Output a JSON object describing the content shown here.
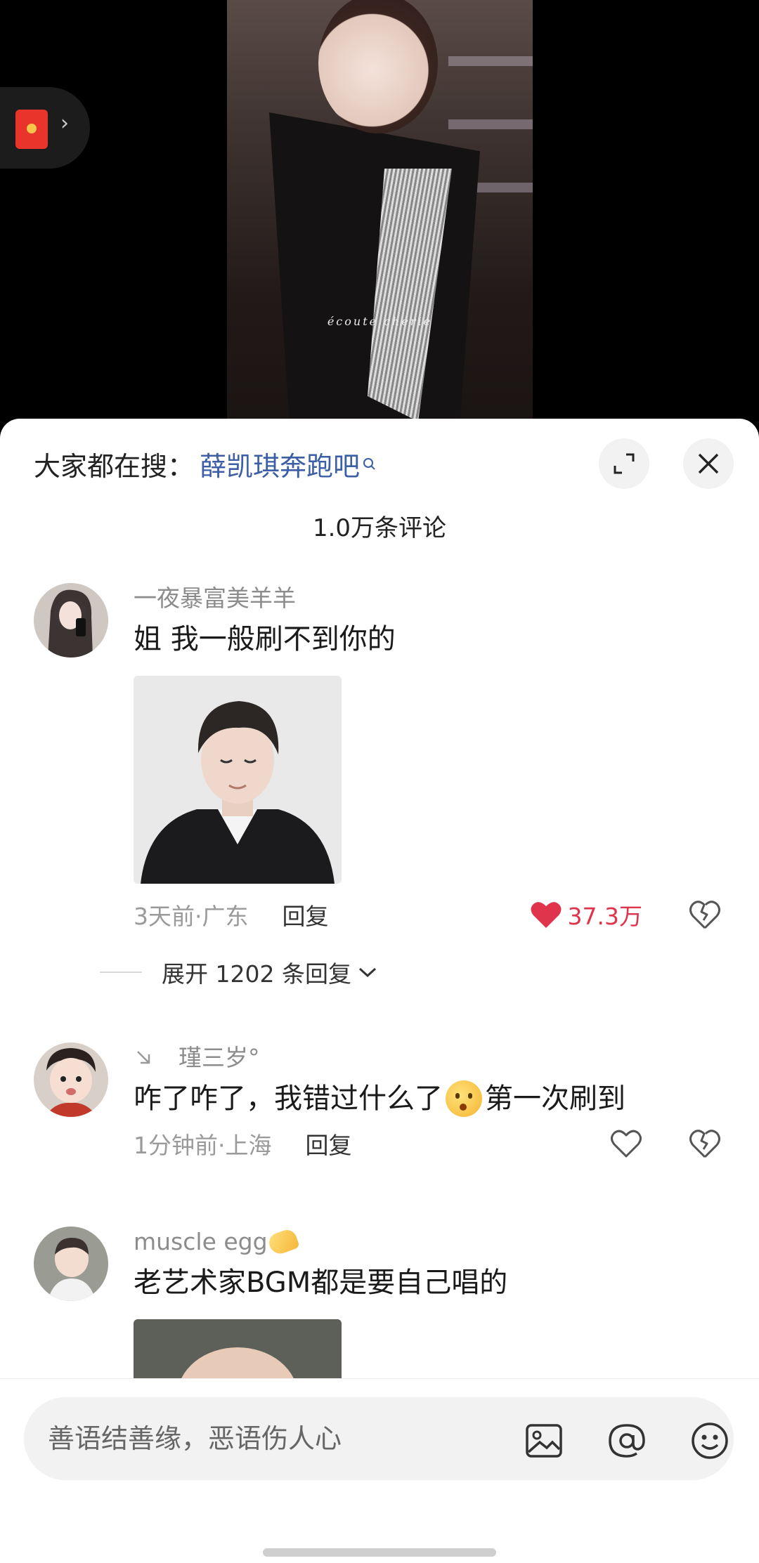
{
  "video": {
    "caption": "écoute chérie"
  },
  "search": {
    "prefix": "大家都在搜：",
    "term": "薛凯琪奔跑吧"
  },
  "comments_header": {
    "count": "1.0万条评论"
  },
  "comments": [
    {
      "user": "一夜暴富美羊羊",
      "text": "姐 我一般刷不到你的",
      "time": "3天前·广东",
      "reply": "回复",
      "likes": "37.3万",
      "liked": true,
      "expand": "展开 1202 条回复"
    },
    {
      "user": "瑾三岁°",
      "text_before": "咋了咋了，我错过什么了",
      "text_after": "第一次刷到",
      "time": "1分钟前·上海",
      "reply": "回复"
    },
    {
      "user": "muscle egg",
      "text": "老艺术家BGM都是要自己唱的"
    }
  ],
  "input": {
    "placeholder": "善语结善缘，恶语伤人心"
  },
  "colors": {
    "accent_link": "#3b5ea7",
    "like_red": "#e0334c"
  }
}
